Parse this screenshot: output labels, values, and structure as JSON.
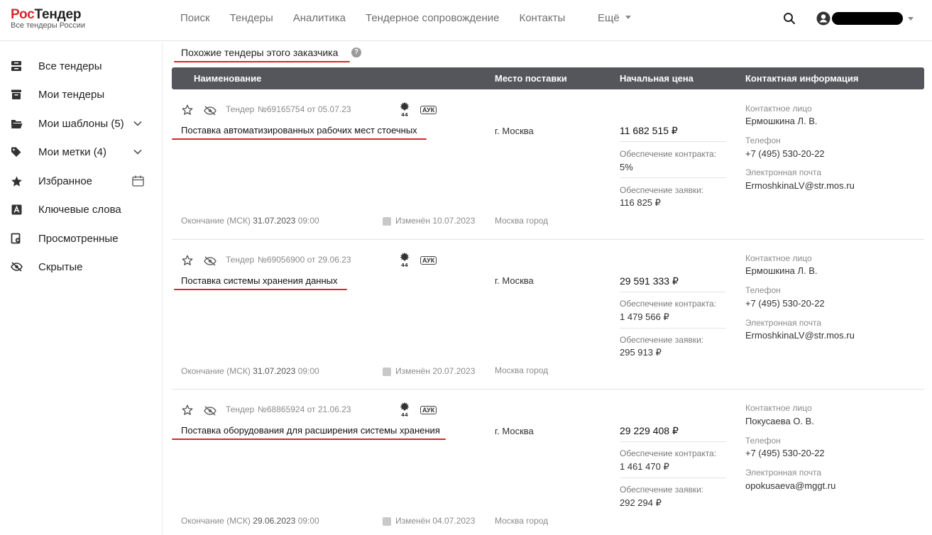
{
  "header": {
    "logo_red": "Рос",
    "logo_dark": "Тендер",
    "logo_sub": "Все тендеры России",
    "nav": [
      "Поиск",
      "Тендеры",
      "Аналитика",
      "Тендерное сопровождение",
      "Контакты"
    ],
    "more": "Ещё"
  },
  "sidebar": {
    "items": [
      {
        "label": "Все тендеры",
        "icon": "all-tenders-icon"
      },
      {
        "label": "Мои тендеры",
        "icon": "my-tenders-icon"
      },
      {
        "label": "Мои шаблоны (5)",
        "icon": "folder-icon"
      },
      {
        "label": "Мои метки (4)",
        "icon": "tag-icon"
      },
      {
        "label": "Избранное",
        "icon": "star-icon"
      },
      {
        "label": "Ключевые слова",
        "icon": "keyword-icon"
      },
      {
        "label": "Просмотренные",
        "icon": "viewed-icon"
      },
      {
        "label": "Скрытые",
        "icon": "hidden-icon"
      }
    ]
  },
  "section": {
    "title": "Похожие тендеры этого заказчика"
  },
  "table": {
    "headers": [
      "Наименование",
      "Место поставки",
      "Начальная цена",
      "Контактная информация"
    ]
  },
  "labels": {
    "tender": "Тендер",
    "auk": "АУК",
    "end": "Окончание (МСК)",
    "changed": "Изменён",
    "contract_security": "Обеспечение контракта:",
    "bid_security": "Обеспечение заявки:",
    "contact_person": "Контактное лицо",
    "phone": "Телефон",
    "email": "Электронная почта"
  },
  "tenders": [
    {
      "number": "№69165754 от 05.07.23",
      "title": "Поставка автоматизированных рабочих мест стоечных",
      "place": "г. Москва",
      "region": "Москва город",
      "price": "11 682 515 ₽",
      "contract_security": "5%",
      "bid_security": "116 825 ₽",
      "end_date": "31.07.2023",
      "end_time": "09:00",
      "changed": "10.07.2023",
      "contact": "Ермошкина Л. В.",
      "phone": "+7 (495) 530-20-22",
      "email": "ErmoshkinaLV@str.mos.ru"
    },
    {
      "number": "№69056900 от 29.06.23",
      "title": "Поставка системы хранения данных",
      "place": "г. Москва",
      "region": "Москва город",
      "price": "29 591 333 ₽",
      "contract_security": "1 479 566 ₽",
      "bid_security": "295 913 ₽",
      "end_date": "31.07.2023",
      "end_time": "09:00",
      "changed": "20.07.2023",
      "contact": "Ермошкина Л. В.",
      "phone": "+7 (495) 530-20-22",
      "email": "ErmoshkinaLV@str.mos.ru"
    },
    {
      "number": "№68865924 от 21.06.23",
      "title": "Поставка оборудования для расширения системы хранения",
      "place": "г. Москва",
      "region": "Москва город",
      "price": "29 229 408 ₽",
      "contract_security": "1 461 470 ₽",
      "bid_security": "292 294 ₽",
      "end_date": "29.06.2023",
      "end_time": "09:00",
      "changed": "04.07.2023",
      "contact": "Покусаева О. В.",
      "phone": "+7 (495) 530-20-22",
      "email": "opokusaeva@mggt.ru"
    }
  ],
  "colors": {
    "accent_red": "#d7262d",
    "header_bar": "#54565b"
  }
}
